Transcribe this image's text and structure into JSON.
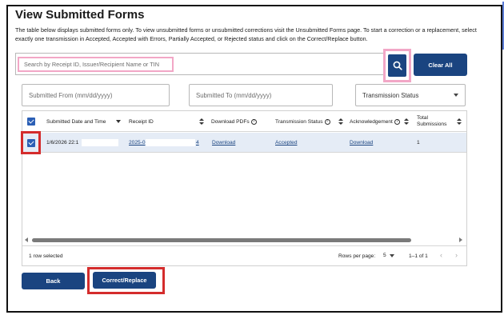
{
  "page": {
    "title": "View Submitted Forms",
    "description": "The table below displays submitted forms only. To view unsubmitted forms or unsubmitted corrections visit the Unsubmitted Forms page. To start a correction or a replacement, select exactly one transmission in Accepted, Accepted with Errors, Partially Accepted, or Rejected status and click on the Correct/Replace button."
  },
  "search": {
    "placeholder": "Search by Receipt ID, Issuer/Recipient Name or TIN",
    "search_icon": "search-icon",
    "clear_label": "Clear All"
  },
  "filters": {
    "from_placeholder": "Submitted From (mm/dd/yyyy)",
    "to_placeholder": "Submitted To (mm/dd/yyyy)",
    "status_label": "Transmission Status"
  },
  "table": {
    "columns": {
      "submitted": "Submitted Date and Time",
      "receipt": "Receipt ID",
      "download": "Download PDFs",
      "status": "Transmission Status",
      "ack": "Acknowledgement",
      "total_line1": "Total",
      "total_line2": "Submissions"
    },
    "rows": [
      {
        "submitted": "1/6/2026 22:1",
        "receipt": "2025-0",
        "receipt_suffix": "4",
        "download": "Download",
        "status": "Accepted",
        "ack": "Download",
        "total": "1"
      }
    ],
    "footer": {
      "selected": "1 row selected",
      "rows_per_page_label": "Rows per page:",
      "rows_per_page_value": "5",
      "range": "1–1 of 1"
    }
  },
  "actions": {
    "back_label": "Back",
    "correct_label": "Correct/Replace"
  },
  "colors": {
    "primary": "#1a4480",
    "highlight_red": "#d42c2c",
    "highlight_pink": "#f2a7c6",
    "row_selected": "#e5ecf6"
  }
}
